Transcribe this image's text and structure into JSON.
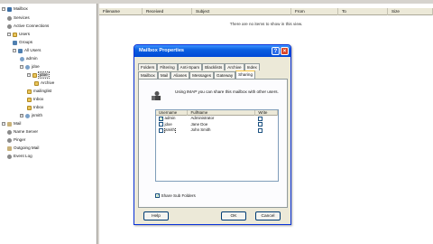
{
  "tree": {
    "items": [
      {
        "label": "Mailbox",
        "icon": "server-icon",
        "expander": "−"
      },
      {
        "label": "Services",
        "icon": "gear-icon"
      },
      {
        "label": "Active Connections",
        "icon": "gear-icon"
      },
      {
        "label": "Users",
        "icon": "folder-icon",
        "expander": "−"
      },
      {
        "label": "Groups",
        "icon": "group-icon"
      },
      {
        "label": "All Users",
        "icon": "group-icon",
        "expander": "−"
      },
      {
        "label": "admin",
        "icon": "user-icon"
      },
      {
        "label": "jdoe",
        "icon": "user-icon",
        "expander": "−"
      },
      {
        "label": "jdoe",
        "icon": "folder-icon",
        "expander": "−"
      },
      {
        "label": "Archive",
        "icon": "folder-icon"
      },
      {
        "label": "mailinglist",
        "icon": "folder-icon"
      },
      {
        "label": "Inbox",
        "icon": "folder-icon"
      },
      {
        "label": "Inbox",
        "icon": "folder-icon"
      },
      {
        "label": "jsmith",
        "icon": "user-icon",
        "expander": "+"
      },
      {
        "label": "Mail",
        "icon": "mail-icon",
        "expander": "−"
      },
      {
        "label": "Name Server",
        "icon": "gear-icon"
      },
      {
        "label": "Pinger",
        "icon": "gear-icon"
      },
      {
        "label": "Outgoing Mail",
        "icon": "mail-icon"
      },
      {
        "label": "Event Log",
        "icon": "gear-icon"
      }
    ]
  },
  "list": {
    "columns": [
      "Filename",
      "Received",
      "Subject",
      "From",
      "To",
      "Size"
    ],
    "empty_message": "There are no items to show in this view."
  },
  "dialog": {
    "title": "Mailbox Properties",
    "help_glyph": "?",
    "close_glyph": "×",
    "tabs_row1": [
      "Folders",
      "Filtering",
      "Anti-Spam",
      "Blacklists",
      "Archive",
      "Index"
    ],
    "tabs_row2": [
      "Mailbox",
      "Mail",
      "Aliases",
      "Messages",
      "Gateway",
      "Sharing"
    ],
    "active_tab": "Sharing",
    "description": "Using IMAP you can share this mailbox with other users.",
    "table": {
      "headers": [
        "Username",
        "FullName",
        "Write"
      ],
      "rows": [
        {
          "username": "admin",
          "fullname": "Administrator",
          "read": true,
          "write": false
        },
        {
          "username": "jdoe",
          "fullname": "Jane Doe",
          "read": false,
          "write": false
        },
        {
          "username": "jsmith",
          "fullname": "John Smith",
          "read": false,
          "write": false
        }
      ]
    },
    "share_subfolders_label": "Share Sub Folders",
    "share_subfolders_checked": true,
    "buttons": {
      "help": "Help",
      "ok": "OK",
      "cancel": "Cancel"
    }
  }
}
